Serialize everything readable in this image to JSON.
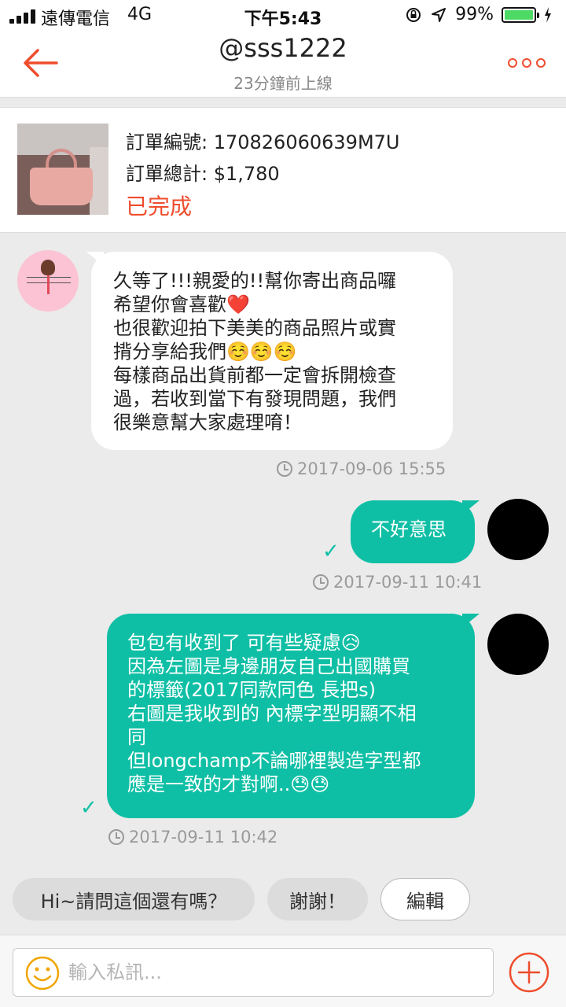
{
  "status_bar": {
    "carrier": "遠傳電信",
    "network": "4G",
    "time": "下午5:43",
    "battery": "99%",
    "battery_level": 0.99
  },
  "header": {
    "title": "@sss1222",
    "subtitle": "23分鐘前上線"
  },
  "order": {
    "number_label": "訂單編號: 170826060639M7U",
    "total_label": "訂單總計: $1,780",
    "status": "已完成"
  },
  "messages": [
    {
      "sender": "seller",
      "lines": [
        "久等了!!!親愛的!!幫你寄出商品囉",
        "希望你會喜歡❤️",
        "也很歡迎拍下美美的商品照片或實",
        "揹分享給我們☺️☺️☺️",
        "每樣商品出貨前都一定會拆開檢查",
        "過，若收到當下有發現問題，我們",
        "很樂意幫大家處理唷！"
      ],
      "time": "2017-09-06 15:55"
    },
    {
      "sender": "me",
      "lines": [
        "不好意思"
      ],
      "time": "2017-09-11 10:41"
    },
    {
      "sender": "me",
      "lines": [
        "包包有收到了 可有些疑慮😥",
        "因為左圖是身邊朋友自己出國購買",
        "的標籤(2017同款同色 長把s)",
        "右圖是我收到的 內標字型明顯不相",
        "同",
        "但longchamp不論哪裡製造字型都",
        "應是一致的才對啊..😓😓"
      ],
      "time": "2017-09-11 10:42"
    }
  ],
  "quick_replies": [
    "Hi~請問這個還有嗎？",
    "謝謝！",
    "編輯"
  ],
  "input": {
    "placeholder": "輸入私訊...",
    "value": ""
  },
  "colors": {
    "accent": "#ee4d2d",
    "outgoing_bubble": "#0fbfa5"
  },
  "icons": [
    "back-arrow-icon",
    "more-icon",
    "clock-icon",
    "check-icon",
    "smiley-icon",
    "plus-icon",
    "signal-icon",
    "lock-rotation-icon",
    "location-icon",
    "battery-icon",
    "charging-icon"
  ]
}
